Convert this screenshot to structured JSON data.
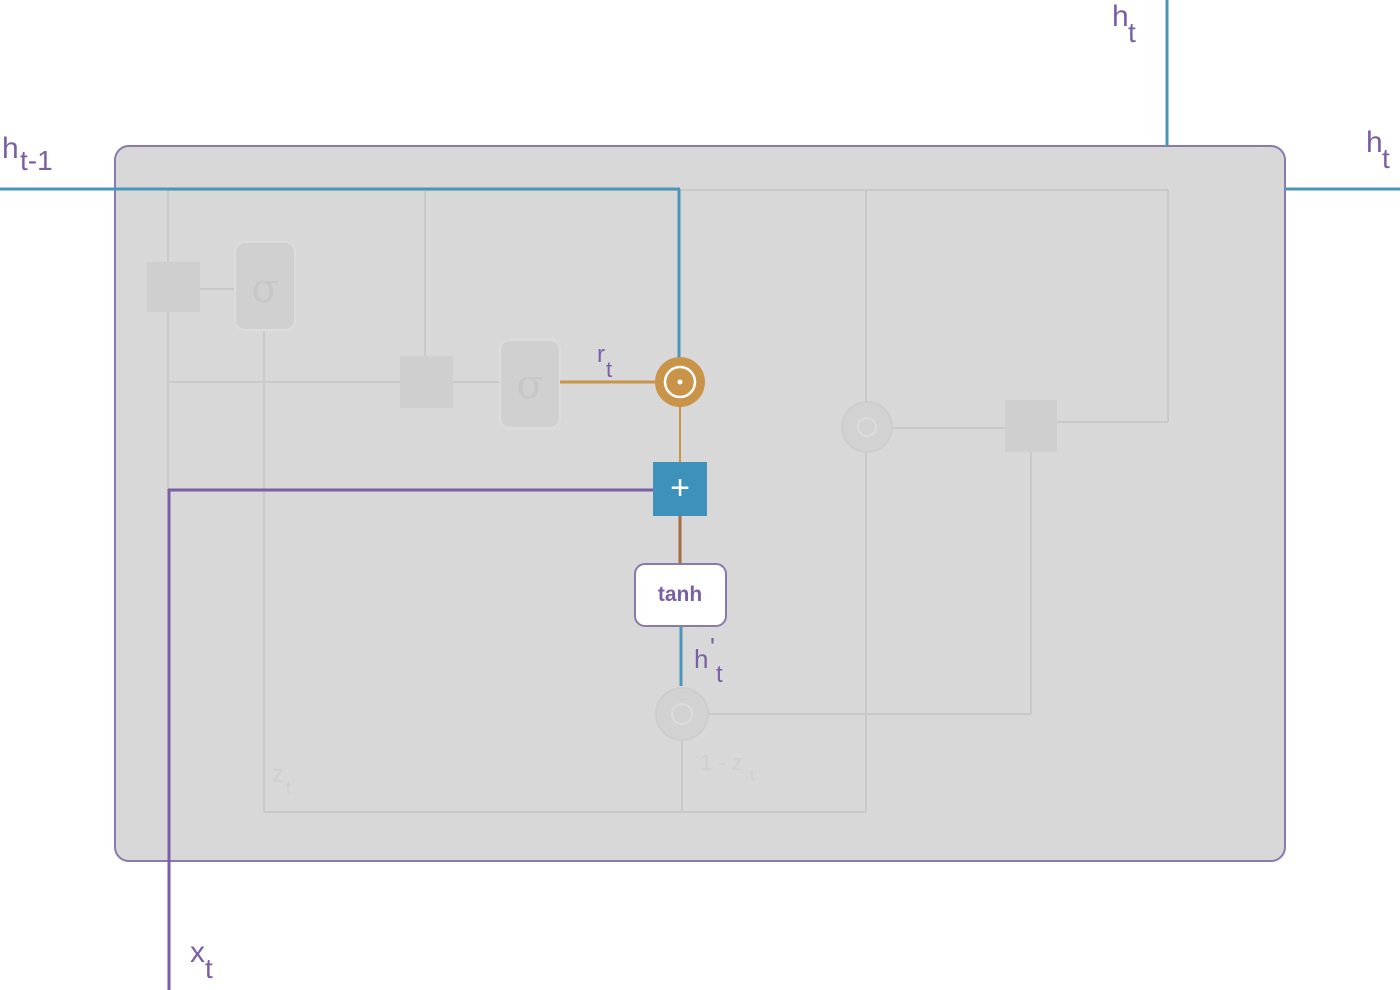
{
  "labels": {
    "h_prev_main": "h",
    "h_prev_sub": "t-1",
    "h_top_main": "h",
    "h_top_sub": "t",
    "h_right_main": "h",
    "h_right_sub": "t",
    "r_main": "r",
    "r_sub": "t",
    "hprime_main": "h",
    "hprime_prime": "'",
    "hprime_sub": "t",
    "x_main": "x",
    "x_sub": "t",
    "z_main": "z",
    "z_sub": "t",
    "one_minus_z": "1 - z",
    "one_minus_z_sub": "t",
    "tanh": "tanh",
    "plus": "+",
    "sigma": "σ",
    "add_small": "+",
    "odot": "⊙"
  },
  "colors": {
    "cell_fill": "#d8d8d8",
    "cell_border": "#8a79ad",
    "h_line": "#4a96b8",
    "x_line": "#7b5fa3",
    "reset_gate": "#c9944a",
    "plus_box": "#3d91bb",
    "faint_line": "#c9c9c9",
    "text": "#7b5fa3"
  }
}
